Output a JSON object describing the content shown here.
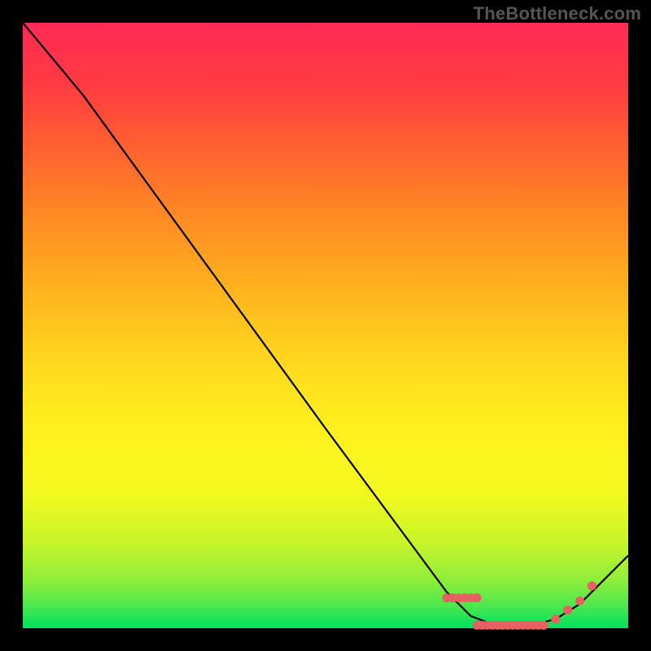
{
  "watermark": "TheBottleneck.com",
  "chart_data": {
    "type": "line",
    "title": "",
    "xlabel": "",
    "ylabel": "",
    "xlim": [
      0,
      100
    ],
    "ylim": [
      0,
      100
    ],
    "background_gradient": {
      "top": "#ff2a56",
      "bottom": "#00e060"
    },
    "series": [
      {
        "name": "curve",
        "points": [
          {
            "x": 0,
            "y": 100
          },
          {
            "x": 5,
            "y": 94
          },
          {
            "x": 10,
            "y": 88
          },
          {
            "x": 50,
            "y": 33
          },
          {
            "x": 70,
            "y": 6
          },
          {
            "x": 74,
            "y": 2
          },
          {
            "x": 78,
            "y": 0.5
          },
          {
            "x": 84,
            "y": 0.5
          },
          {
            "x": 88,
            "y": 1.5
          },
          {
            "x": 92,
            "y": 4
          },
          {
            "x": 100,
            "y": 12
          }
        ]
      }
    ],
    "marker_clusters": [
      {
        "name": "left-cluster",
        "x_start": 70,
        "x_end": 75,
        "y": 5,
        "count": 6
      },
      {
        "name": "floor-cluster",
        "x_start": 75,
        "x_end": 86,
        "y": 0.5,
        "count": 14
      },
      {
        "name": "right-1",
        "x_start": 88,
        "x_end": 88,
        "y": 1.5,
        "count": 1
      },
      {
        "name": "right-2",
        "x_start": 90,
        "x_end": 90,
        "y": 3,
        "count": 1
      },
      {
        "name": "right-3",
        "x_start": 92,
        "x_end": 92,
        "y": 4.5,
        "count": 1
      },
      {
        "name": "right-4",
        "x_start": 94,
        "x_end": 94,
        "y": 7,
        "count": 1
      }
    ]
  }
}
